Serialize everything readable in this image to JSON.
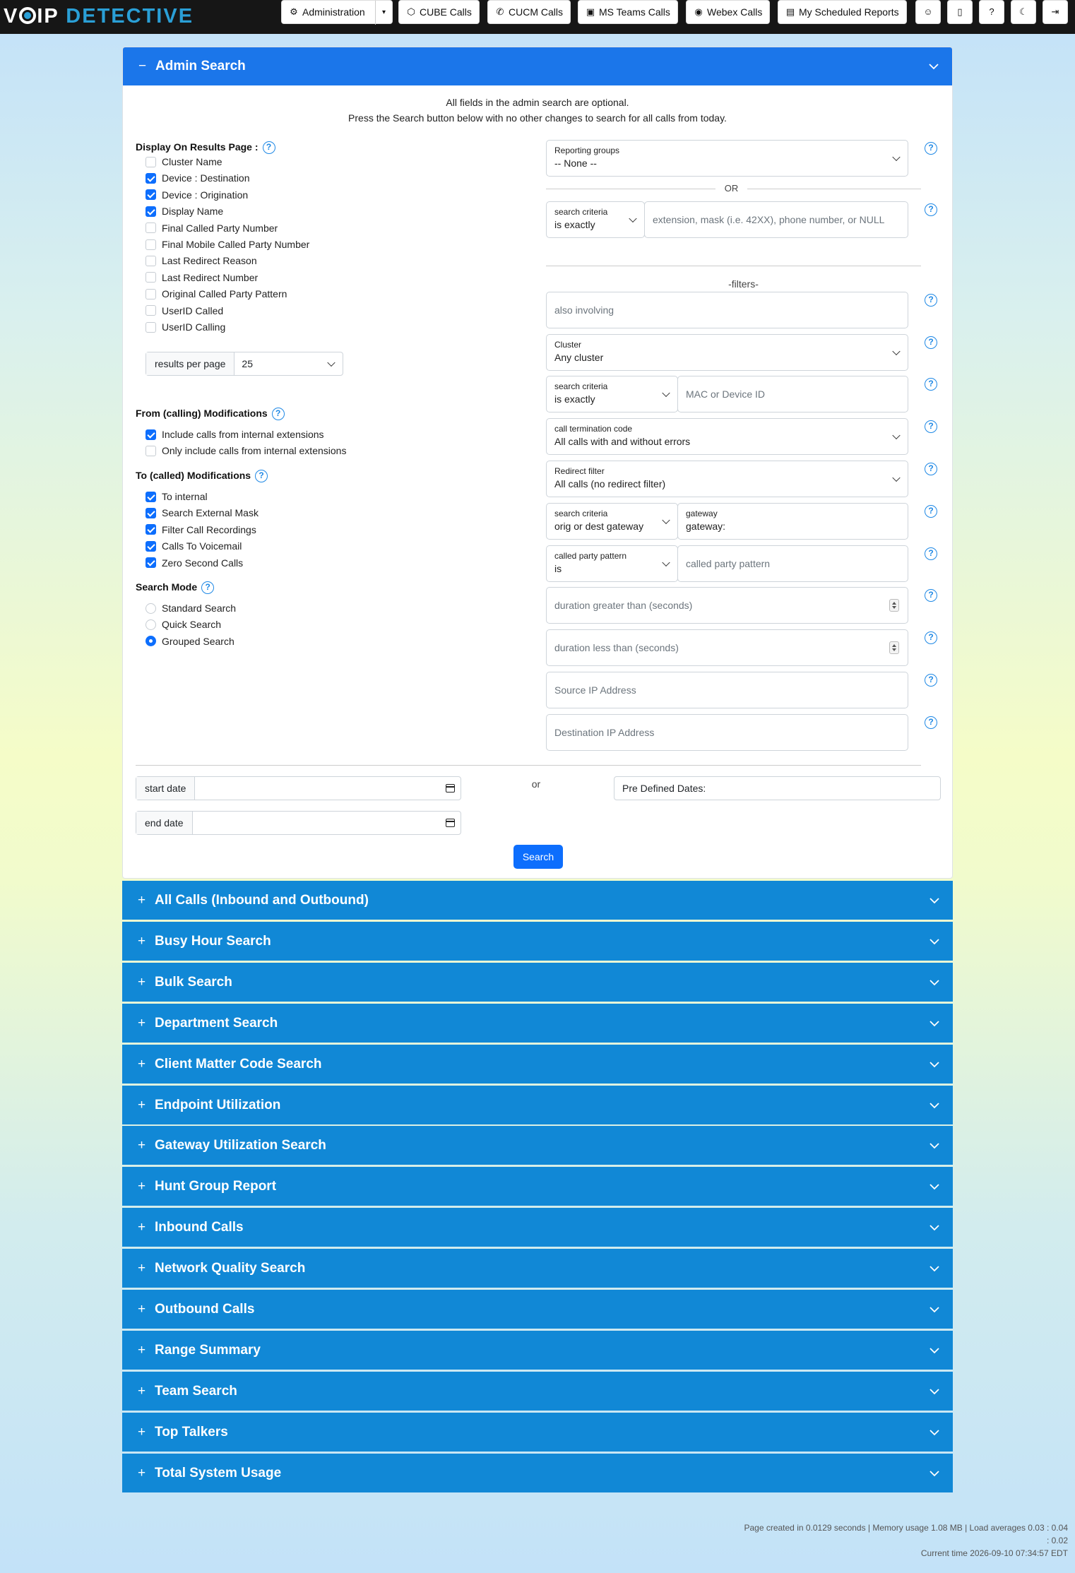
{
  "nav": {
    "brand_v": "V",
    "brand_o": "O",
    "brand_ip": "IP",
    "brand_detective": "DETECTIVE",
    "buttons": [
      {
        "label": "Administration",
        "icon": "gear-icon"
      },
      {
        "label": "CUBE Calls",
        "icon": "cube-icon"
      },
      {
        "label": "CUCM Calls",
        "icon": "phone-icon"
      },
      {
        "label": "MS Teams Calls",
        "icon": "teams-icon"
      },
      {
        "label": "Webex Calls",
        "icon": "webex-icon"
      },
      {
        "label": "My Scheduled Reports",
        "icon": "report-icon"
      }
    ],
    "icon_buttons": [
      "user-icon",
      "notes-icon",
      "help-icon",
      "moon-icon",
      "logout-icon"
    ],
    "icon_glyphs": {
      "gear": "⚙",
      "cube": "⬡",
      "phone": "✆",
      "teams": "▣",
      "webex": "◉",
      "report": "▤",
      "user": "☺",
      "notes": "▯",
      "help": "?",
      "moon": "☾",
      "logout": "⇥",
      "caret": "▾"
    }
  },
  "admin": {
    "title": "Admin Search",
    "sign": "−",
    "intro_1": "All fields in the admin search are optional.",
    "intro_2": "Press the Search button below with no other changes to search for all calls from today.",
    "display_label": "Display On Results Page :",
    "display_options": [
      {
        "label": "Cluster Name",
        "checked": false
      },
      {
        "label": "Device : Destination",
        "checked": true
      },
      {
        "label": "Device : Origination",
        "checked": true
      },
      {
        "label": "Display Name",
        "checked": true
      },
      {
        "label": "Final Called Party Number",
        "checked": false
      },
      {
        "label": "Final Mobile Called Party Number",
        "checked": false
      },
      {
        "label": "Last Redirect Reason",
        "checked": false
      },
      {
        "label": "Last Redirect Number",
        "checked": false
      },
      {
        "label": "Original Called Party Pattern",
        "checked": false
      },
      {
        "label": "UserID Called",
        "checked": false
      },
      {
        "label": "UserID Calling",
        "checked": false
      }
    ],
    "results_per_page_label": "results per page",
    "results_per_page_value": "25",
    "from_label": "From (calling) Modifications",
    "from_options": [
      {
        "label": "Include calls from internal extensions",
        "checked": true
      },
      {
        "label": "Only include calls from internal extensions",
        "checked": false
      }
    ],
    "to_label": "To (called) Modifications",
    "to_options": [
      {
        "label": "To internal",
        "checked": true
      },
      {
        "label": "Search External Mask",
        "checked": true
      },
      {
        "label": "Filter Call Recordings",
        "checked": true
      },
      {
        "label": "Calls To Voicemail",
        "checked": true
      },
      {
        "label": "Zero Second Calls",
        "checked": true
      }
    ],
    "mode_label": "Search Mode",
    "mode_options": [
      {
        "label": "Standard Search",
        "checked": false
      },
      {
        "label": "Quick Search",
        "checked": false
      },
      {
        "label": "Grouped Search",
        "checked": true
      }
    ],
    "reporting_groups_label": "Reporting groups",
    "reporting_groups_value": "-- None --",
    "or_text": "OR",
    "criteria_label": "search criteria",
    "criteria_value": "is exactly",
    "extension_placeholder": "extension, mask (i.e. 42XX), phone number, or NULL",
    "filters_label": "-filters-",
    "also_involving_placeholder": "also involving",
    "cluster_label": "Cluster",
    "cluster_value": "Any cluster",
    "device_criteria_label": "search criteria",
    "device_criteria_value": "is exactly",
    "device_placeholder": "MAC or Device ID",
    "termination_label": "call termination code",
    "termination_value": "All calls with and without errors",
    "redirect_label": "Redirect filter",
    "redirect_value": "All calls (no redirect filter)",
    "gw_criteria_label": "search criteria",
    "gw_criteria_value": "orig or dest gateway",
    "gateway_label": "gateway",
    "gateway_value": "gateway:",
    "cpp_label": "called party pattern",
    "cpp_value": "is",
    "cpp_placeholder": "called party pattern",
    "dur_gt_placeholder": "duration greater than (seconds)",
    "dur_lt_placeholder": "duration less than (seconds)",
    "src_ip_placeholder": "Source IP Address",
    "dst_ip_placeholder": "Destination IP Address",
    "start_date_label": "start date",
    "end_date_label": "end date",
    "or_small": "or",
    "predefined_label": "Pre Defined Dates:",
    "search_button": "Search",
    "help_glyph": "?"
  },
  "accordions": [
    "All Calls (Inbound and Outbound)",
    "Busy Hour Search",
    "Bulk Search",
    "Department Search",
    "Client Matter Code Search",
    "Endpoint Utilization",
    "Gateway Utilization Search",
    "Hunt Group Report",
    "Inbound Calls",
    "Network Quality Search",
    "Outbound Calls",
    "Range Summary",
    "Team Search",
    "Top Talkers",
    "Total System Usage"
  ],
  "accordion_sign": "+",
  "footer": {
    "line1": "Page created in 0.0129 seconds | Memory usage 1.08 MB | Load averages 0.03 : 0.04",
    "line2": ": 0.02",
    "line3": "Current time 2026-09-10 07:34:57 EDT"
  },
  "colors": {
    "nav_bg": "#161616",
    "brand_blue": "#2a9fd6",
    "admin_header": "#1b76ea",
    "accordion": "#1188d6",
    "primary": "#0d6efd"
  }
}
